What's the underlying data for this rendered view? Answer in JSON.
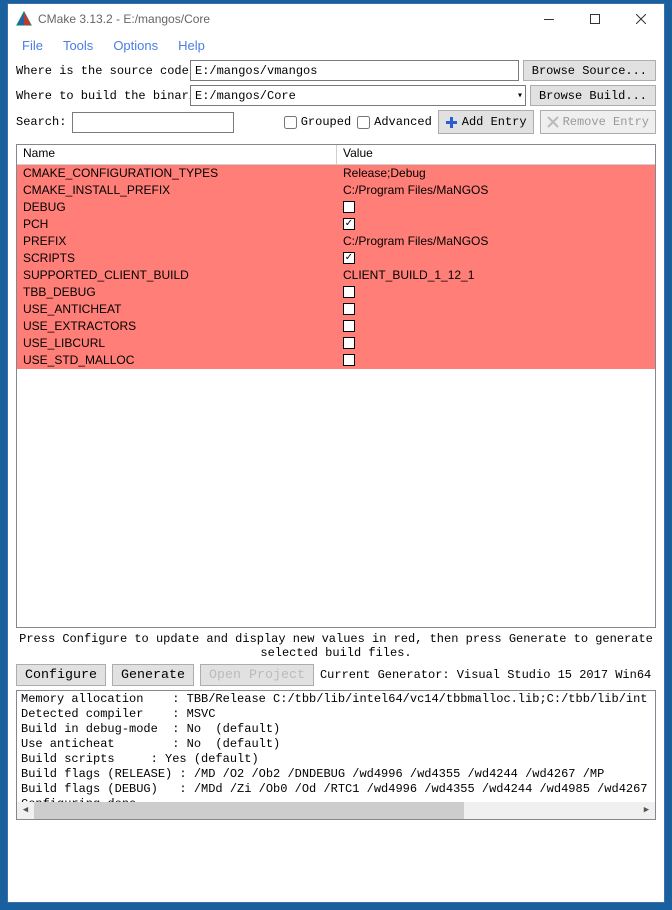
{
  "titlebar": {
    "title": "CMake 3.13.2 - E:/mangos/Core"
  },
  "menu": {
    "file": "File",
    "tools": "Tools",
    "options": "Options",
    "help": "Help"
  },
  "source": {
    "label": "Where is the source code:",
    "path": "E:/mangos/vmangos",
    "browse": "Browse Source..."
  },
  "build": {
    "label": "Where to build the binaries:",
    "path": "E:/mangos/Core",
    "browse": "Browse Build..."
  },
  "search": {
    "label": "Search:",
    "value": ""
  },
  "checks": {
    "grouped": "Grouped",
    "advanced": "Advanced"
  },
  "entry_btns": {
    "add": "Add Entry",
    "remove": "Remove Entry"
  },
  "table": {
    "col_name": "Name",
    "col_value": "Value",
    "rows": [
      {
        "name": "CMAKE_CONFIGURATION_TYPES",
        "type": "text",
        "value": "Release;Debug"
      },
      {
        "name": "CMAKE_INSTALL_PREFIX",
        "type": "text",
        "value": "C:/Program Files/MaNGOS"
      },
      {
        "name": "DEBUG",
        "type": "check",
        "checked": false
      },
      {
        "name": "PCH",
        "type": "check",
        "checked": true
      },
      {
        "name": "PREFIX",
        "type": "text",
        "value": "C:/Program Files/MaNGOS"
      },
      {
        "name": "SCRIPTS",
        "type": "check",
        "checked": true
      },
      {
        "name": "SUPPORTED_CLIENT_BUILD",
        "type": "text",
        "value": "CLIENT_BUILD_1_12_1"
      },
      {
        "name": "TBB_DEBUG",
        "type": "check",
        "checked": false
      },
      {
        "name": "USE_ANTICHEAT",
        "type": "check",
        "checked": false
      },
      {
        "name": "USE_EXTRACTORS",
        "type": "check",
        "checked": false
      },
      {
        "name": "USE_LIBCURL",
        "type": "check",
        "checked": false
      },
      {
        "name": "USE_STD_MALLOC",
        "type": "check",
        "checked": false
      }
    ]
  },
  "hint": "Press Configure to update and display new values in red, then press Generate to generate selected build\nfiles.",
  "gen": {
    "configure": "Configure",
    "generate": "Generate",
    "open": "Open Project",
    "current": "Current Generator: Visual Studio 15 2017 Win64"
  },
  "log": "Memory allocation    : TBB/Release C:/tbb/lib/intel64/vc14/tbbmalloc.lib;C:/tbb/lib/int\nDetected compiler    : MSVC\nBuild in debug-mode  : No  (default)\nUse anticheat        : No  (default)\nBuild scripts     : Yes (default)\nBuild flags (RELEASE) : /MD /O2 /Ob2 /DNDEBUG /wd4996 /wd4355 /wd4244 /wd4267 /MP\nBuild flags (DEBUG)   : /MDd /Zi /Ob0 /Od /RTC1 /wd4996 /wd4355 /wd4244 /wd4985 /wd4267\nConfiguring done"
}
